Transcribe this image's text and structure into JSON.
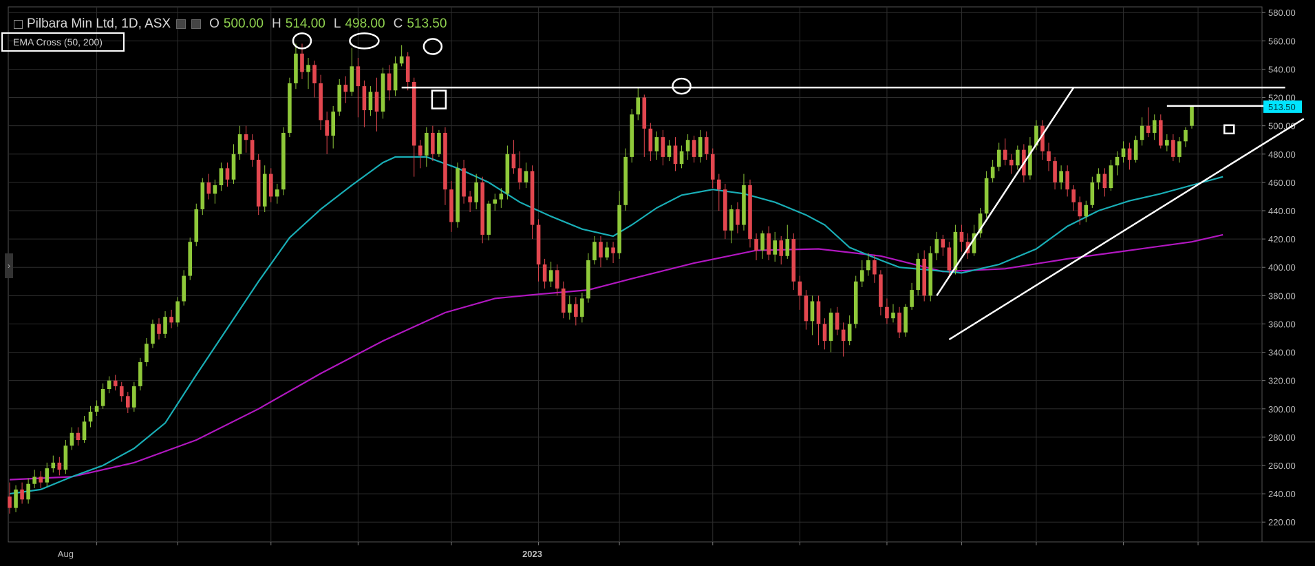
{
  "header": {
    "symbol_title": "Pilbara Min Ltd, 1D, ASX",
    "open_key": "O",
    "open_val": "500.00",
    "high_key": "H",
    "high_val": "514.00",
    "low_key": "L",
    "low_val": "498.00",
    "close_key": "C",
    "close_val": "513.50"
  },
  "indicator": {
    "label": "EMA Cross (50, 200)"
  },
  "colors": {
    "up": "#8fc93a",
    "down": "#e2474f",
    "ema_fast": "#19aeb6",
    "ema_slow": "#b117c0",
    "grid": "#2e2e2e",
    "axis_text": "#bdbdbd",
    "annotation": "#ffffff",
    "price_tag": "#00e5ff"
  },
  "chart_data": {
    "type": "candlestick",
    "title": "Pilbara Min Ltd, 1D, ASX",
    "ylim": [
      206,
      584
    ],
    "y_ticks": [
      580,
      560,
      540,
      520,
      500,
      480,
      460,
      440,
      420,
      400,
      380,
      360,
      340,
      320,
      300,
      280,
      260,
      240,
      220
    ],
    "x_labels": [
      {
        "label": "Aug",
        "i": 9
      },
      {
        "label": "2023",
        "i": 84
      }
    ],
    "last_price_label": "513.50",
    "grid": true,
    "candles": [
      [
        238,
        230,
        248,
        226
      ],
      [
        230,
        243,
        246,
        227
      ],
      [
        243,
        236,
        248,
        233
      ],
      [
        236,
        247,
        251,
        233
      ],
      [
        247,
        252,
        257,
        244
      ],
      [
        252,
        248,
        256,
        244
      ],
      [
        248,
        258,
        262,
        245
      ],
      [
        258,
        262,
        267,
        255
      ],
      [
        262,
        257,
        266,
        253
      ],
      [
        257,
        274,
        278,
        254
      ],
      [
        274,
        283,
        287,
        271
      ],
      [
        283,
        278,
        287,
        274
      ],
      [
        278,
        291,
        295,
        276
      ],
      [
        291,
        298,
        302,
        287
      ],
      [
        298,
        302,
        306,
        295
      ],
      [
        302,
        314,
        318,
        300
      ],
      [
        314,
        320,
        323,
        311
      ],
      [
        320,
        316,
        324,
        313
      ],
      [
        316,
        309,
        319,
        305
      ],
      [
        309,
        301,
        312,
        297
      ],
      [
        301,
        316,
        319,
        298
      ],
      [
        316,
        333,
        336,
        313
      ],
      [
        333,
        346,
        350,
        330
      ],
      [
        346,
        360,
        363,
        343
      ],
      [
        360,
        353,
        364,
        349
      ],
      [
        353,
        365,
        369,
        350
      ],
      [
        365,
        361,
        370,
        357
      ],
      [
        361,
        376,
        379,
        358
      ],
      [
        376,
        394,
        398,
        373
      ],
      [
        394,
        418,
        421,
        391
      ],
      [
        418,
        441,
        445,
        415
      ],
      [
        441,
        460,
        463,
        437
      ],
      [
        460,
        452,
        466,
        448
      ],
      [
        452,
        458,
        462,
        445
      ],
      [
        458,
        470,
        474,
        454
      ],
      [
        470,
        462,
        474,
        457
      ],
      [
        462,
        480,
        487,
        459
      ],
      [
        480,
        494,
        500,
        476
      ],
      [
        494,
        490,
        500,
        481
      ],
      [
        490,
        476,
        494,
        471
      ],
      [
        476,
        443,
        480,
        437
      ],
      [
        443,
        466,
        472,
        439
      ],
      [
        466,
        450,
        470,
        446
      ],
      [
        450,
        455,
        459,
        445
      ],
      [
        455,
        495,
        499,
        451
      ],
      [
        495,
        530,
        534,
        492
      ],
      [
        530,
        551,
        558,
        526
      ],
      [
        551,
        538,
        558,
        533
      ],
      [
        538,
        543,
        548,
        526
      ],
      [
        543,
        530,
        546,
        520
      ],
      [
        530,
        504,
        536,
        497
      ],
      [
        504,
        493,
        510,
        480
      ],
      [
        493,
        510,
        514,
        484
      ],
      [
        510,
        529,
        533,
        507
      ],
      [
        529,
        524,
        535,
        516
      ],
      [
        524,
        542,
        555,
        521
      ],
      [
        542,
        528,
        548,
        506
      ],
      [
        528,
        511,
        532,
        499
      ],
      [
        511,
        524,
        528,
        507
      ],
      [
        524,
        510,
        534,
        496
      ],
      [
        510,
        537,
        541,
        505
      ],
      [
        537,
        525,
        543,
        518
      ],
      [
        525,
        544,
        549,
        521
      ],
      [
        544,
        549,
        557,
        542
      ],
      [
        549,
        531,
        552,
        525
      ],
      [
        531,
        486,
        534,
        464
      ],
      [
        486,
        479,
        490,
        470
      ],
      [
        479,
        495,
        499,
        471
      ],
      [
        495,
        480,
        500,
        475
      ],
      [
        480,
        495,
        497,
        478
      ],
      [
        495,
        455,
        499,
        444
      ],
      [
        455,
        432,
        461,
        425
      ],
      [
        432,
        470,
        474,
        428
      ],
      [
        470,
        450,
        476,
        445
      ],
      [
        450,
        446,
        454,
        439
      ],
      [
        446,
        460,
        466,
        441
      ],
      [
        460,
        423,
        464,
        417
      ],
      [
        423,
        445,
        447,
        419
      ],
      [
        445,
        448,
        452,
        440
      ],
      [
        448,
        452,
        456,
        442
      ],
      [
        452,
        480,
        486,
        448
      ],
      [
        480,
        470,
        490,
        466
      ],
      [
        470,
        460,
        482,
        455
      ],
      [
        460,
        468,
        474,
        456
      ],
      [
        468,
        430,
        472,
        420
      ],
      [
        430,
        402,
        434,
        390
      ],
      [
        402,
        390,
        406,
        385
      ],
      [
        390,
        398,
        404,
        386
      ],
      [
        398,
        385,
        402,
        380
      ],
      [
        385,
        368,
        390,
        364
      ],
      [
        368,
        374,
        380,
        363
      ],
      [
        374,
        365,
        379,
        359
      ],
      [
        365,
        378,
        382,
        361
      ],
      [
        378,
        405,
        410,
        375
      ],
      [
        405,
        418,
        422,
        402
      ],
      [
        418,
        407,
        422,
        400
      ],
      [
        407,
        414,
        418,
        405
      ],
      [
        414,
        410,
        418,
        403
      ],
      [
        410,
        444,
        454,
        406
      ],
      [
        444,
        478,
        484,
        440
      ],
      [
        478,
        508,
        512,
        474
      ],
      [
        508,
        520,
        527,
        504
      ],
      [
        520,
        498,
        522,
        478
      ],
      [
        498,
        482,
        502,
        475
      ],
      [
        482,
        492,
        496,
        476
      ],
      [
        492,
        478,
        497,
        472
      ],
      [
        478,
        486,
        490,
        475
      ],
      [
        486,
        473,
        492,
        468
      ],
      [
        473,
        482,
        486,
        470
      ],
      [
        482,
        490,
        494,
        476
      ],
      [
        490,
        478,
        493,
        474
      ],
      [
        478,
        492,
        497,
        474
      ],
      [
        492,
        480,
        496,
        476
      ],
      [
        480,
        462,
        484,
        456
      ],
      [
        462,
        455,
        466,
        440
      ],
      [
        455,
        426,
        459,
        420
      ],
      [
        426,
        441,
        444,
        417
      ],
      [
        441,
        430,
        446,
        424
      ],
      [
        430,
        458,
        466,
        426
      ],
      [
        458,
        420,
        462,
        414
      ],
      [
        420,
        412,
        424,
        405
      ],
      [
        412,
        424,
        426,
        406
      ],
      [
        424,
        409,
        429,
        405
      ],
      [
        409,
        419,
        425,
        404
      ],
      [
        419,
        408,
        422,
        402
      ],
      [
        408,
        420,
        430,
        406
      ],
      [
        420,
        390,
        424,
        384
      ],
      [
        390,
        380,
        394,
        370
      ],
      [
        380,
        362,
        384,
        356
      ],
      [
        362,
        376,
        380,
        352
      ],
      [
        376,
        360,
        380,
        345
      ],
      [
        360,
        348,
        364,
        342
      ],
      [
        348,
        368,
        371,
        340
      ],
      [
        368,
        356,
        372,
        352
      ],
      [
        356,
        348,
        361,
        337
      ],
      [
        348,
        360,
        366,
        345
      ],
      [
        360,
        390,
        394,
        357
      ],
      [
        390,
        398,
        405,
        386
      ],
      [
        398,
        405,
        410,
        394
      ],
      [
        405,
        395,
        409,
        389
      ],
      [
        395,
        372,
        398,
        366
      ],
      [
        372,
        364,
        378,
        360
      ],
      [
        364,
        368,
        374,
        361
      ],
      [
        368,
        354,
        372,
        350
      ],
      [
        354,
        372,
        374,
        351
      ],
      [
        372,
        384,
        389,
        370
      ],
      [
        384,
        406,
        410,
        380
      ],
      [
        406,
        380,
        412,
        376
      ],
      [
        380,
        410,
        415,
        376
      ],
      [
        410,
        420,
        425,
        405
      ],
      [
        420,
        414,
        423,
        408
      ],
      [
        414,
        398,
        418,
        394
      ],
      [
        398,
        425,
        430,
        395
      ],
      [
        425,
        418,
        430,
        411
      ],
      [
        418,
        410,
        424,
        406
      ],
      [
        410,
        424,
        430,
        408
      ],
      [
        424,
        438,
        442,
        421
      ],
      [
        438,
        463,
        468,
        435
      ],
      [
        463,
        471,
        476,
        460
      ],
      [
        471,
        483,
        488,
        468
      ],
      [
        483,
        476,
        491,
        472
      ],
      [
        476,
        472,
        480,
        466
      ],
      [
        472,
        483,
        486,
        469
      ],
      [
        483,
        465,
        487,
        460
      ],
      [
        465,
        486,
        492,
        462
      ],
      [
        486,
        500,
        504,
        483
      ],
      [
        500,
        482,
        504,
        476
      ],
      [
        482,
        475,
        488,
        468
      ],
      [
        475,
        460,
        478,
        455
      ],
      [
        460,
        468,
        472,
        455
      ],
      [
        468,
        455,
        472,
        450
      ],
      [
        455,
        446,
        458,
        440
      ],
      [
        446,
        436,
        450,
        430
      ],
      [
        436,
        444,
        447,
        432
      ],
      [
        444,
        460,
        464,
        442
      ],
      [
        460,
        466,
        470,
        455
      ],
      [
        466,
        456,
        470,
        450
      ],
      [
        456,
        472,
        476,
        454
      ],
      [
        472,
        478,
        482,
        465
      ],
      [
        478,
        484,
        489,
        474
      ],
      [
        484,
        476,
        488,
        469
      ],
      [
        476,
        490,
        493,
        474
      ],
      [
        490,
        500,
        506,
        486
      ],
      [
        500,
        495,
        513,
        492
      ],
      [
        495,
        504,
        508,
        490
      ],
      [
        504,
        486,
        508,
        484
      ],
      [
        486,
        490,
        494,
        482
      ],
      [
        490,
        478,
        494,
        475
      ],
      [
        478,
        489,
        492,
        474
      ],
      [
        489,
        497,
        499,
        485
      ],
      [
        500,
        513.5,
        514,
        498
      ]
    ],
    "ema_fast": [
      [
        0,
        240
      ],
      [
        5,
        243
      ],
      [
        10,
        252
      ],
      [
        15,
        260
      ],
      [
        20,
        272
      ],
      [
        25,
        290
      ],
      [
        30,
        324
      ],
      [
        35,
        357
      ],
      [
        40,
        390
      ],
      [
        45,
        421
      ],
      [
        50,
        441
      ],
      [
        55,
        458
      ],
      [
        60,
        474
      ],
      [
        62,
        478
      ],
      [
        67,
        478
      ],
      [
        72,
        470
      ],
      [
        77,
        460
      ],
      [
        82,
        446
      ],
      [
        87,
        436
      ],
      [
        92,
        427
      ],
      [
        97,
        422
      ],
      [
        100,
        430
      ],
      [
        104,
        442
      ],
      [
        108,
        451
      ],
      [
        113,
        455
      ],
      [
        118,
        452
      ],
      [
        123,
        446
      ],
      [
        128,
        437
      ],
      [
        131,
        430
      ],
      [
        135,
        414
      ],
      [
        140,
        405
      ],
      [
        143,
        400
      ],
      [
        148,
        398
      ],
      [
        153,
        396
      ],
      [
        159,
        402
      ],
      [
        165,
        413
      ],
      [
        170,
        429
      ],
      [
        175,
        440
      ],
      [
        180,
        447
      ],
      [
        185,
        452
      ],
      [
        190,
        458
      ],
      [
        195,
        464
      ]
    ],
    "ema_slow": [
      [
        0,
        250
      ],
      [
        10,
        252
      ],
      [
        20,
        262
      ],
      [
        30,
        278
      ],
      [
        40,
        300
      ],
      [
        50,
        325
      ],
      [
        60,
        348
      ],
      [
        70,
        368
      ],
      [
        78,
        378
      ],
      [
        85,
        381
      ],
      [
        93,
        384
      ],
      [
        100,
        392
      ],
      [
        110,
        403
      ],
      [
        120,
        412
      ],
      [
        130,
        413
      ],
      [
        140,
        408
      ],
      [
        150,
        397
      ],
      [
        160,
        399
      ],
      [
        170,
        406
      ],
      [
        180,
        412
      ],
      [
        190,
        418
      ],
      [
        195,
        423
      ]
    ],
    "annotations": {
      "resistance": [
        [
          63,
          527
        ],
        [
          205,
          527
        ]
      ],
      "recent_high_line": [
        [
          186,
          514
        ],
        [
          204,
          514
        ]
      ],
      "support_upper": [
        [
          151,
          349
        ],
        [
          208,
          505
        ]
      ],
      "wedge_left": [
        [
          149,
          380
        ],
        [
          171,
          527
        ]
      ],
      "circles": [
        [
          47,
          560
        ],
        [
          57,
          560
        ],
        [
          68,
          556
        ],
        [
          108,
          528
        ]
      ],
      "boxes": [
        [
          69,
          520
        ],
        [
          196,
          497
        ]
      ]
    }
  }
}
